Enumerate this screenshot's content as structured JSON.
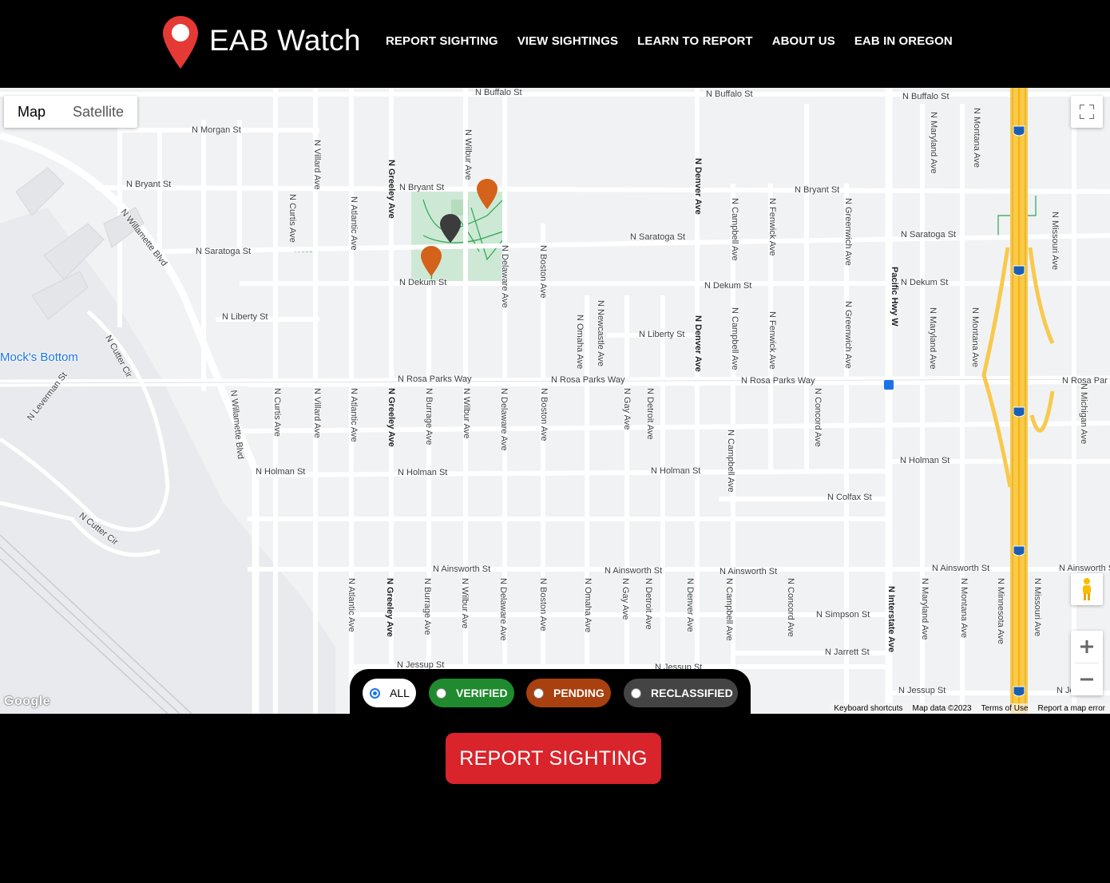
{
  "app": {
    "title": "EAB Watch",
    "logo_icon": "map-pin-icon",
    "accent": "#e53935"
  },
  "nav": {
    "items": [
      {
        "label": "REPORT SIGHTING"
      },
      {
        "label": "VIEW SIGHTINGS"
      },
      {
        "label": "LEARN TO REPORT"
      },
      {
        "label": "ABOUT US"
      },
      {
        "label": "EAB IN OREGON"
      }
    ]
  },
  "map": {
    "type_controls": {
      "map": "Map",
      "satellite": "Satellite",
      "active": "Map"
    },
    "labels": {
      "buffalo1": "N Buffalo St",
      "buffalo2": "N Buffalo St",
      "buffalo3": "N Buffalo St",
      "morgan": "N Morgan St",
      "bryant1": "N Bryant St",
      "bryant2": "N Bryant St",
      "bryant3": "N Bryant St",
      "willamette": "N Willamette Blvd",
      "saratoga1": "N Saratoga St",
      "saratoga2": "N Saratoga St",
      "saratoga3": "N Saratoga St",
      "dekum1": "N Dekum St",
      "dekum2": "N Dekum St",
      "dekum3": "N Dekum St",
      "liberty1": "N Liberty St",
      "liberty2": "N Liberty St",
      "mocks": "Mock's Bottom",
      "cutter1": "N Cutter Cir",
      "cutter2": "N Cutter Cir",
      "leverman": "N Leverman St",
      "rosaparks1": "N Rosa Parks Way",
      "rosaparks2": "N Rosa Parks Way",
      "rosaparks3": "N Rosa Parks Way",
      "rosaparks4": "N Rosa Par",
      "willamette_blvd2": "N Willamette Blvd",
      "holman1": "N Holman St",
      "holman2": "N Holman St",
      "holman3": "N Holman St",
      "holman4": "N Holman St",
      "colfax": "N Colfax St",
      "ainsworth1": "N Ainsworth St",
      "ainsworth2": "N Ainsworth St",
      "ainsworth3": "N Ainsworth St",
      "ainsworth4": "N Ainsworth St",
      "ainsworth5": "N Ainsworth S",
      "simpson": "N Simpson St",
      "jarrett": "N Jarrett St",
      "jessup1": "N Jessup St",
      "jessup2": "N Jessup St",
      "jessup3": "N Jessup St",
      "jessup4": "N Jes",
      "villard1": "N Villard Ave",
      "villard2": "N Villard Ave",
      "curtis1": "N Curtis Ave",
      "curtis2": "N Curtis Ave",
      "atlantic1": "N Atlantic Ave",
      "atlantic2": "N Atlantic Ave",
      "atlantic3": "N Atlantic Ave",
      "greeley1": "N Greeley Ave",
      "greeley2": "N Greeley Ave",
      "greeley3": "N Greeley Ave",
      "wilbur1": "N Wilbur Ave",
      "wilbur2": "N Wilbur Ave",
      "wilbur3": "N Wilbur Ave",
      "delaware1": "N Delaware Ave",
      "delaware2": "N Delaware Ave",
      "delaware3": "N Delaware Ave",
      "boston1": "N Boston Ave",
      "boston2": "N Boston Ave",
      "boston3": "N Boston Ave",
      "burrage1": "N Burrage Ave",
      "burrage2": "N Burrage Ave",
      "omaha1": "N Omaha Ave",
      "omaha2": "N Omaha Ave",
      "newcastle": "N Newcastle Ave",
      "gay1": "N Gay Ave",
      "gay2": "N Gay Ave",
      "detroit1": "N Detroit Ave",
      "detroit2": "N Detroit Ave",
      "denver1": "N Denver Ave",
      "denver2": "N Denver Ave",
      "denver3": "N Denver Ave",
      "campbell1": "N Campbell Ave",
      "campbell2": "N Campbell Ave",
      "campbell3": "N Campbell Ave",
      "campbell4": "N Campbell Ave",
      "fenwick1": "N Fenwick Ave",
      "fenwick2": "N Fenwick Ave",
      "greenwich1": "N Greenwich Ave",
      "greenwich2": "N Greenwich Ave",
      "concord1": "N Concord Ave",
      "concord2": "N Concord Ave",
      "pacific": "Pacific Hwy W",
      "interstate": "N Interstate Ave",
      "maryland1": "N Maryland Ave",
      "maryland2": "N Maryland Ave",
      "maryland3": "N Maryland Ave",
      "montana1": "N Montana Ave",
      "montana2": "N Montana Ave",
      "montana3": "N Montana Ave",
      "minnesota": "N Minnesota Ave",
      "missouri1": "N Missouri Ave",
      "missouri2": "N Missouri Ave",
      "michigan1": "N Michigan Ave",
      "michigan2": "igan A",
      "shield": "5"
    },
    "pins": [
      {
        "status": "pending",
        "color": "#d4621a"
      },
      {
        "status": "reclassified",
        "color": "#3c3c3c"
      },
      {
        "status": "pending",
        "color": "#d4621a"
      }
    ],
    "google": "Google",
    "attribution": {
      "shortcuts": "Keyboard shortcuts",
      "data": "Map data ©2023",
      "terms": "Terms of Use",
      "report": "Report a map error"
    }
  },
  "filters": {
    "selected": "ALL",
    "options": [
      {
        "label": "ALL",
        "color": "#ffffff"
      },
      {
        "label": "VERIFIED",
        "color": "#1f8a2e"
      },
      {
        "label": "PENDING",
        "color": "#a8400f"
      },
      {
        "label": "RECLASSIFIED",
        "color": "#444444"
      }
    ]
  },
  "cta": {
    "label": "REPORT SIGHTING",
    "color": "#d9242b"
  }
}
